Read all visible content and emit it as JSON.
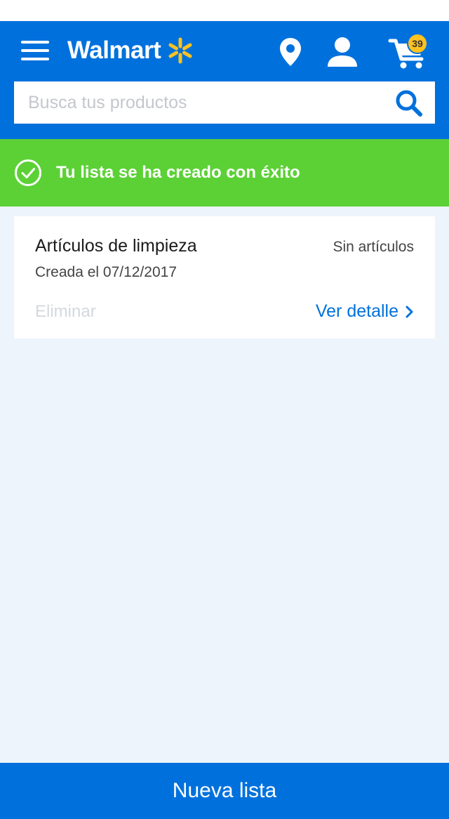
{
  "header": {
    "brand": "Walmart",
    "cart_count": "39",
    "search": {
      "placeholder": "Busca tus productos"
    },
    "icons": [
      "menu-icon",
      "walmart-spark-icon",
      "location-pin-icon",
      "account-icon",
      "cart-icon",
      "search-icon"
    ]
  },
  "banner": {
    "message": "Tu lista se ha creado con éxito",
    "icon": "check-circle-icon"
  },
  "list_card": {
    "title": "Artículos de limpieza",
    "count_label": "Sin artículos",
    "created_label": "Creada el 07/12/2017",
    "delete_label": "Eliminar",
    "detail_label": "Ver detalle"
  },
  "footer": {
    "new_list_label": "Nueva lista"
  },
  "colors": {
    "brand_blue": "#0071dc",
    "spark_yellow": "#ffc220",
    "success_green": "#5cd136",
    "page_background": "#edf4fc"
  }
}
